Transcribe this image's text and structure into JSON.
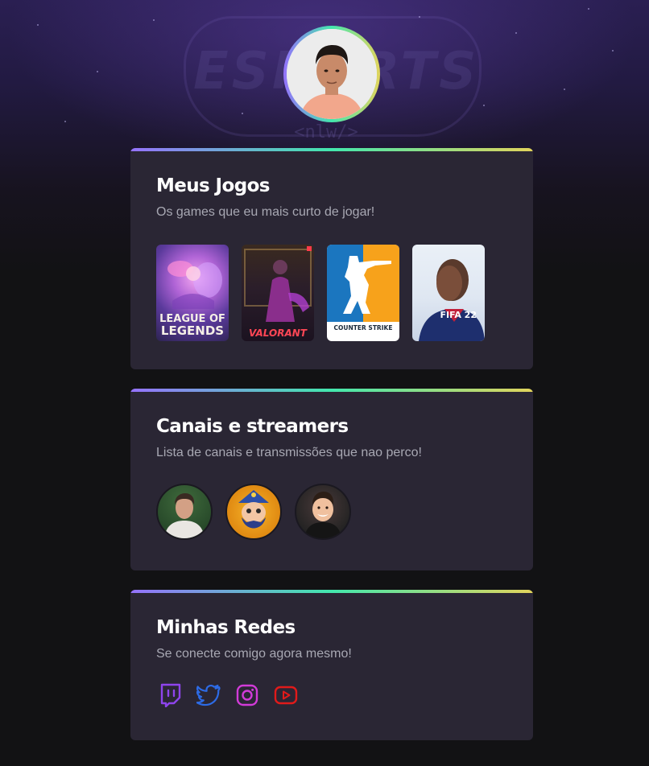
{
  "profile": {
    "avatar_alt": "Foto de perfil"
  },
  "background": {
    "logo_text": "ESPORTS",
    "logo_sub": "<nlw/>"
  },
  "cards": [
    {
      "title": "Meus Jogos",
      "subtitle": "Os games que eu mais curto de jogar!"
    },
    {
      "title": "Canais e streamers",
      "subtitle": "Lista de canais e transmissões que nao perco!"
    },
    {
      "title": "Minhas Redes",
      "subtitle": "Se conecte comigo agora mesmo!"
    }
  ],
  "games": [
    {
      "name": "League of Legends",
      "line1": "LEAGUE OF",
      "line2": "LEGENDS"
    },
    {
      "name": "Valorant",
      "line1": "VALORANT"
    },
    {
      "name": "Counter-Strike",
      "line1": "COUNTER STRIKE"
    },
    {
      "name": "FIFA 22",
      "line1": "FIFA 22"
    }
  ],
  "socials": [
    {
      "name": "Twitch",
      "icon": "twitch-icon",
      "color": "#8e44ec"
    },
    {
      "name": "Twitter",
      "icon": "twitter-icon",
      "color": "#2d6be6"
    },
    {
      "name": "Instagram",
      "icon": "instagram-icon",
      "color": "#d23bd8"
    },
    {
      "name": "YouTube",
      "icon": "youtube-icon",
      "color": "#e11a1a"
    }
  ],
  "colors": {
    "gradient": [
      "#9572fc",
      "#43e7ad",
      "#e2d45c"
    ],
    "card_bg": "#2a2634",
    "page_bg": "#121214",
    "text_secondary": "#a8a8b3"
  }
}
